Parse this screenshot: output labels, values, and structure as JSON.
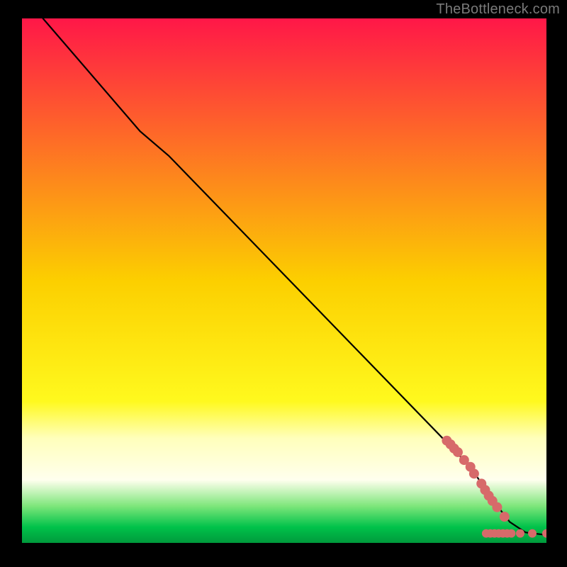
{
  "attribution": "TheBottleneck.com",
  "chart_data": {
    "type": "line",
    "title": "",
    "xlabel": "",
    "ylabel": "",
    "xlim": [
      0,
      100
    ],
    "ylim": [
      0,
      100
    ],
    "gradient_stops": [
      {
        "offset": 0.0,
        "color": "#ff1748"
      },
      {
        "offset": 0.5,
        "color": "#fccf00"
      },
      {
        "offset": 0.73,
        "color": "#fff91e"
      },
      {
        "offset": 0.8,
        "color": "#ffffbb"
      },
      {
        "offset": 0.88,
        "color": "#ffffee"
      },
      {
        "offset": 0.93,
        "color": "#7de67a"
      },
      {
        "offset": 0.97,
        "color": "#00c24a"
      },
      {
        "offset": 1.0,
        "color": "#009a3c"
      }
    ],
    "series": [
      {
        "name": "curve",
        "type": "line",
        "color": "#000000",
        "points": [
          {
            "x": 4.0,
            "y": 100.0
          },
          {
            "x": 22.5,
            "y": 78.5
          },
          {
            "x": 28.0,
            "y": 73.8
          },
          {
            "x": 85.5,
            "y": 14.5
          },
          {
            "x": 89.5,
            "y": 8.5
          },
          {
            "x": 93.0,
            "y": 4.0
          },
          {
            "x": 96.0,
            "y": 2.0
          },
          {
            "x": 100.0,
            "y": 1.5
          }
        ]
      },
      {
        "name": "markers",
        "type": "scatter",
        "color": "#d76a6a",
        "radius_default": 7,
        "points": [
          {
            "x": 81.0,
            "y": 19.5,
            "r": 7
          },
          {
            "x": 81.7,
            "y": 18.8,
            "r": 7
          },
          {
            "x": 82.4,
            "y": 18.0,
            "r": 7
          },
          {
            "x": 83.1,
            "y": 17.3,
            "r": 7
          },
          {
            "x": 84.3,
            "y": 15.8,
            "r": 7
          },
          {
            "x": 85.5,
            "y": 14.5,
            "r": 7
          },
          {
            "x": 86.2,
            "y": 13.2,
            "r": 7
          },
          {
            "x": 87.6,
            "y": 11.3,
            "r": 7
          },
          {
            "x": 88.3,
            "y": 10.1,
            "r": 7
          },
          {
            "x": 89.0,
            "y": 9.0,
            "r": 7
          },
          {
            "x": 89.7,
            "y": 8.0,
            "r": 7
          },
          {
            "x": 90.6,
            "y": 6.8,
            "r": 7
          },
          {
            "x": 92.0,
            "y": 5.0,
            "r": 7
          },
          {
            "x": 88.5,
            "y": 1.8,
            "r": 6
          },
          {
            "x": 89.3,
            "y": 1.8,
            "r": 6
          },
          {
            "x": 90.1,
            "y": 1.8,
            "r": 6
          },
          {
            "x": 90.9,
            "y": 1.8,
            "r": 6
          },
          {
            "x": 91.7,
            "y": 1.8,
            "r": 6
          },
          {
            "x": 92.5,
            "y": 1.8,
            "r": 6
          },
          {
            "x": 93.3,
            "y": 1.8,
            "r": 6
          },
          {
            "x": 95.0,
            "y": 1.8,
            "r": 6
          },
          {
            "x": 97.3,
            "y": 1.8,
            "r": 6
          },
          {
            "x": 100.0,
            "y": 1.8,
            "r": 6
          }
        ]
      }
    ]
  }
}
